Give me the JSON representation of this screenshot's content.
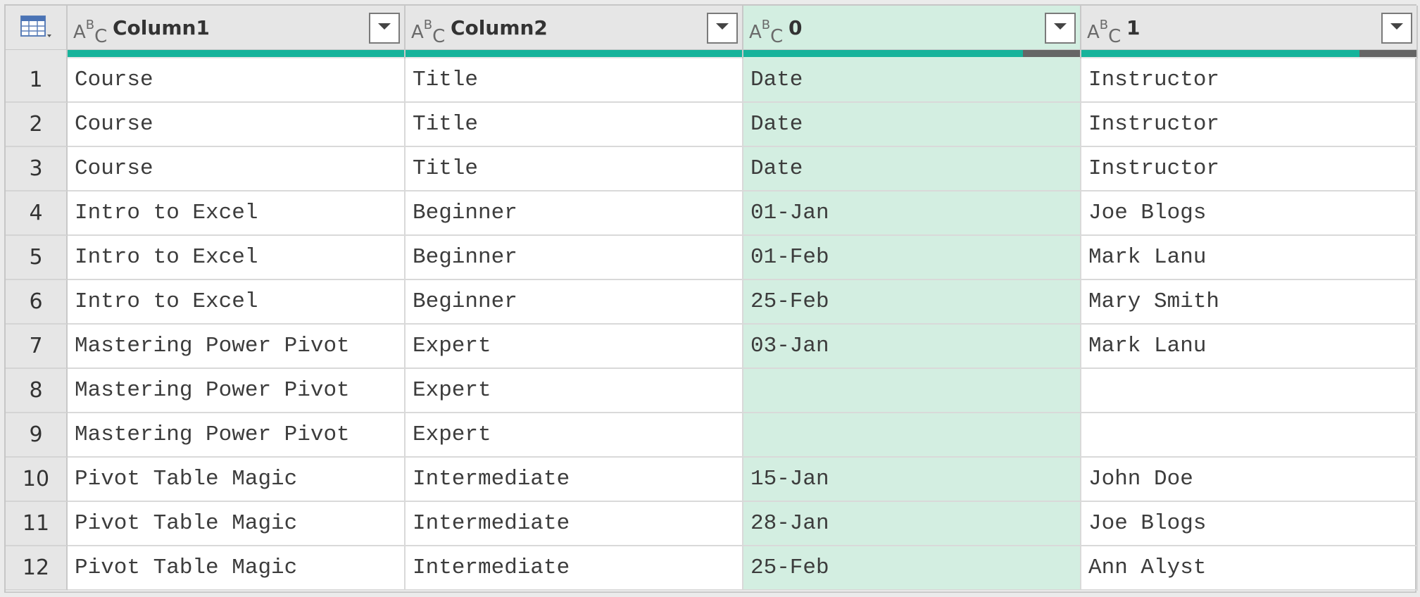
{
  "columns": [
    {
      "label": "Column1",
      "type_icon": "text-type-icon",
      "quality": 1.0
    },
    {
      "label": "Column2",
      "type_icon": "text-type-icon",
      "quality": 1.0
    },
    {
      "label": "0",
      "type_icon": "text-type-icon",
      "quality": 0.83
    },
    {
      "label": "1",
      "type_icon": "text-type-icon",
      "quality": 0.83
    }
  ],
  "selected_column": 2,
  "colors": {
    "accent_valid": "#16b39b",
    "empty": "#666666",
    "selected": "#d3eee1"
  },
  "rows": [
    {
      "n": "1",
      "cells": [
        "Course",
        "Title",
        "Date",
        "Instructor"
      ]
    },
    {
      "n": "2",
      "cells": [
        "Course",
        "Title",
        "Date",
        "Instructor"
      ]
    },
    {
      "n": "3",
      "cells": [
        "Course",
        "Title",
        "Date",
        "Instructor"
      ]
    },
    {
      "n": "4",
      "cells": [
        "Intro to Excel",
        "Beginner",
        "01-Jan",
        "Joe Blogs"
      ]
    },
    {
      "n": "5",
      "cells": [
        "Intro to Excel",
        "Beginner",
        "01-Feb",
        "Mark Lanu"
      ]
    },
    {
      "n": "6",
      "cells": [
        "Intro to Excel",
        "Beginner",
        "25-Feb",
        "Mary Smith"
      ]
    },
    {
      "n": "7",
      "cells": [
        "Mastering Power Pivot",
        "Expert",
        "03-Jan",
        "Mark Lanu"
      ]
    },
    {
      "n": "8",
      "cells": [
        "Mastering Power Pivot",
        "Expert",
        "",
        ""
      ]
    },
    {
      "n": "9",
      "cells": [
        "Mastering Power Pivot",
        "Expert",
        "",
        ""
      ]
    },
    {
      "n": "10",
      "cells": [
        "Pivot Table Magic",
        "Intermediate",
        "15-Jan",
        "John Doe"
      ]
    },
    {
      "n": "11",
      "cells": [
        "Pivot Table Magic",
        "Intermediate",
        "28-Jan",
        "Joe Blogs"
      ]
    },
    {
      "n": "12",
      "cells": [
        "Pivot Table Magic",
        "Intermediate",
        "25-Feb",
        "Ann Alyst"
      ]
    }
  ]
}
